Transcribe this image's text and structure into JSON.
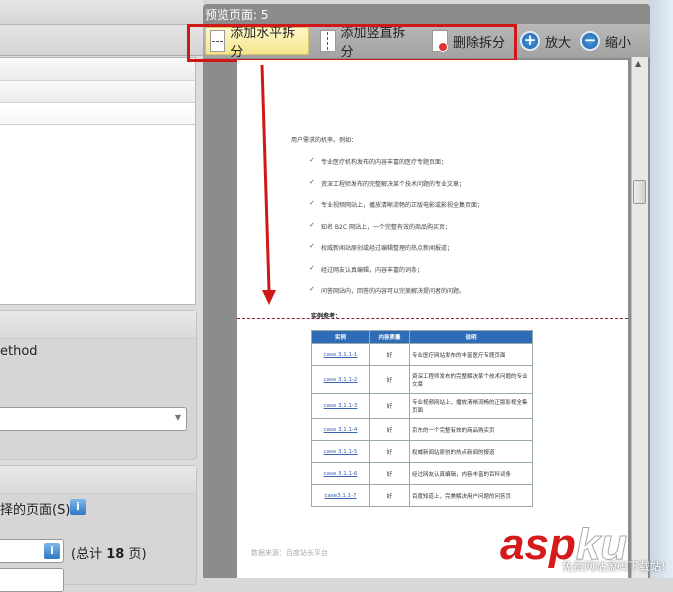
{
  "left": {
    "method_text": "ethod",
    "pages_label": "择的页面(S)",
    "info_icon": "i",
    "total_prefix": "(总计 ",
    "total_count": "18",
    "total_suffix": " 页)"
  },
  "preview": {
    "title": "预览页面: 5",
    "toolbar": {
      "add_horizontal": "添加水平拆分",
      "add_vertical": "添加竖直拆分",
      "delete_split": "删除拆分",
      "zoom_in": "放大",
      "zoom_out": "缩小"
    }
  },
  "doc": {
    "intro": "用户需求的机率。例如：",
    "bullets": [
      "专业医疗机构发布的内容丰富的医疗专题页面；",
      "资深工程师发布的完整解决某个技术问题的专业文章；",
      "专业视频网站上，播放清晰流畅的正版电影或影视全集页面；",
      "知名 B2C 网站上，一个完整有效的商品购买页；",
      "权威新闻站原创或经过编辑整理的热点新闻报道；",
      "经过网友认真编辑，内容丰富的词条；",
      "问答网站内，回答的内容可以完美解决提问者的问题。"
    ],
    "section": "实例参考：",
    "table": {
      "headers": [
        "实例",
        "内容质量",
        "说明"
      ],
      "rows": [
        [
          "case 3.1.1-1",
          "好",
          "专业医疗网站发布的丰富医疗专题页面"
        ],
        [
          "case 3.1.1-2",
          "好",
          "资深工程师发布的完整解决某个技术问题的专业文章"
        ],
        [
          "case 3.1.1-3",
          "好",
          "专业视频网站上，播放清晰流畅的正版影视全集页面"
        ],
        [
          "case 3.1.1-4",
          "好",
          "京东的一个完整有效的商品购买页"
        ],
        [
          "case 3.1.1-5",
          "好",
          "权威新闻站原创的热点新闻的报道"
        ],
        [
          "case 3.1.1-6",
          "好",
          "经过网友认真编辑，内容丰富的百科词条"
        ],
        [
          "case3.1.1-7",
          "好",
          "百度知道上，完美解决用户问题的问答页"
        ]
      ]
    },
    "footer": "数据来源：百度站长平台"
  },
  "watermark": {
    "brand": "asp",
    "brand2": "ku",
    ".com": ".com",
    "tagline": "免费网站源码下载站!"
  },
  "colors": {
    "accent_red": "#d01818",
    "table_header": "#2f6cb5"
  }
}
